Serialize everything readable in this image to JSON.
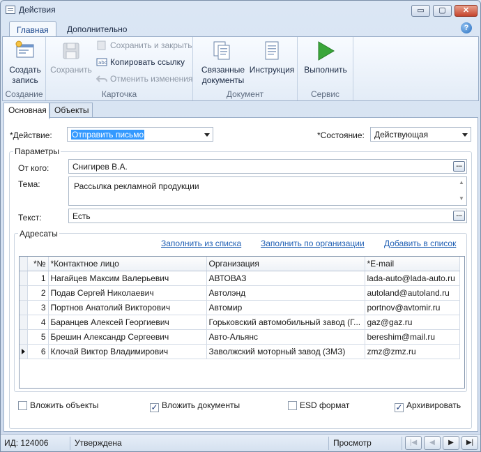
{
  "window": {
    "title": "Действия",
    "min_label": "▭",
    "max_label": "▢",
    "close_label": "✕"
  },
  "ribbon_tabs": [
    {
      "label": "Главная",
      "active": true
    },
    {
      "label": "Дополнительно",
      "active": false
    }
  ],
  "ribbon": {
    "groups": {
      "create": "Создание",
      "card": "Карточка",
      "document": "Документ",
      "service": "Сервис"
    },
    "create_record": "Создать\nзапись",
    "save": "Сохранить",
    "save_and_close": "Сохранить и закрыть",
    "copy_link": "Копировать ссылку",
    "undo_changes": "Отменить изменения",
    "related_docs": "Связанные\nдокументы",
    "instruction": "Инструкция",
    "execute": "Выполнить"
  },
  "doc_tabs": [
    {
      "label": "Основная",
      "active": true
    },
    {
      "label": "Объекты",
      "active": false
    }
  ],
  "form": {
    "action_label": "*Действие:",
    "action_value": "Отправить письмо",
    "state_label": "*Состояние:",
    "state_value": "Действующая",
    "params_legend": "Параметры",
    "from_label": "От кого:",
    "from_value": "Снигирев В.А.",
    "subject_label": "Тема:",
    "subject_value": "Рассылка рекламной продукции",
    "text_label": "Текст:",
    "text_value": "Есть",
    "recipients_legend": "Адресаты"
  },
  "links": {
    "fill_from_list": "Заполнить из списка",
    "fill_by_org": "Заполнить по организации",
    "add_to_list": "Добавить в список"
  },
  "grid": {
    "columns": [
      "*№",
      "*Контактное лицо",
      "Организация",
      "*E-mail"
    ],
    "rows": [
      {
        "n": "1",
        "contact": "Нагайцев Максим Валерьевич",
        "org": "АВТОВАЗ",
        "email": "lada-auto@lada-auto.ru",
        "current": false
      },
      {
        "n": "2",
        "contact": "Подав Сергей Николаевич",
        "org": "Автолэнд",
        "email": "autoland@autoland.ru",
        "current": false
      },
      {
        "n": "3",
        "contact": "Портнов Анатолий Викторович",
        "org": "Автомир",
        "email": "portnov@avtomir.ru",
        "current": false
      },
      {
        "n": "4",
        "contact": "Баранцев Алексей Георгиевич",
        "org": "Горьковский автомобильный завод (Г...",
        "email": "gaz@gaz.ru",
        "current": false
      },
      {
        "n": "5",
        "contact": "Брешин Александр Сергеевич",
        "org": "Авто-Альянс",
        "email": "bereshim@mail.ru",
        "current": false
      },
      {
        "n": "6",
        "contact": "Клочай Виктор Владимирович",
        "org": "Заволжский моторный завод (ЗМЗ)",
        "email": "zmz@zmz.ru",
        "current": true
      }
    ]
  },
  "checkboxes": {
    "attach_objects": {
      "label": "Вложить объекты",
      "checked": false
    },
    "attach_docs": {
      "label": "Вложить документы",
      "checked": true
    },
    "esd_format": {
      "label": "ESD формат",
      "checked": false
    },
    "archive": {
      "label": "Архивировать",
      "checked": true
    }
  },
  "status": {
    "id": "ИД: 124006",
    "state": "Утверждена",
    "mode": "Просмотр"
  },
  "colors": {
    "accent": "#15428b",
    "link": "#1f5fb4",
    "selection": "#3399ff",
    "execute": "#3aa63a"
  }
}
